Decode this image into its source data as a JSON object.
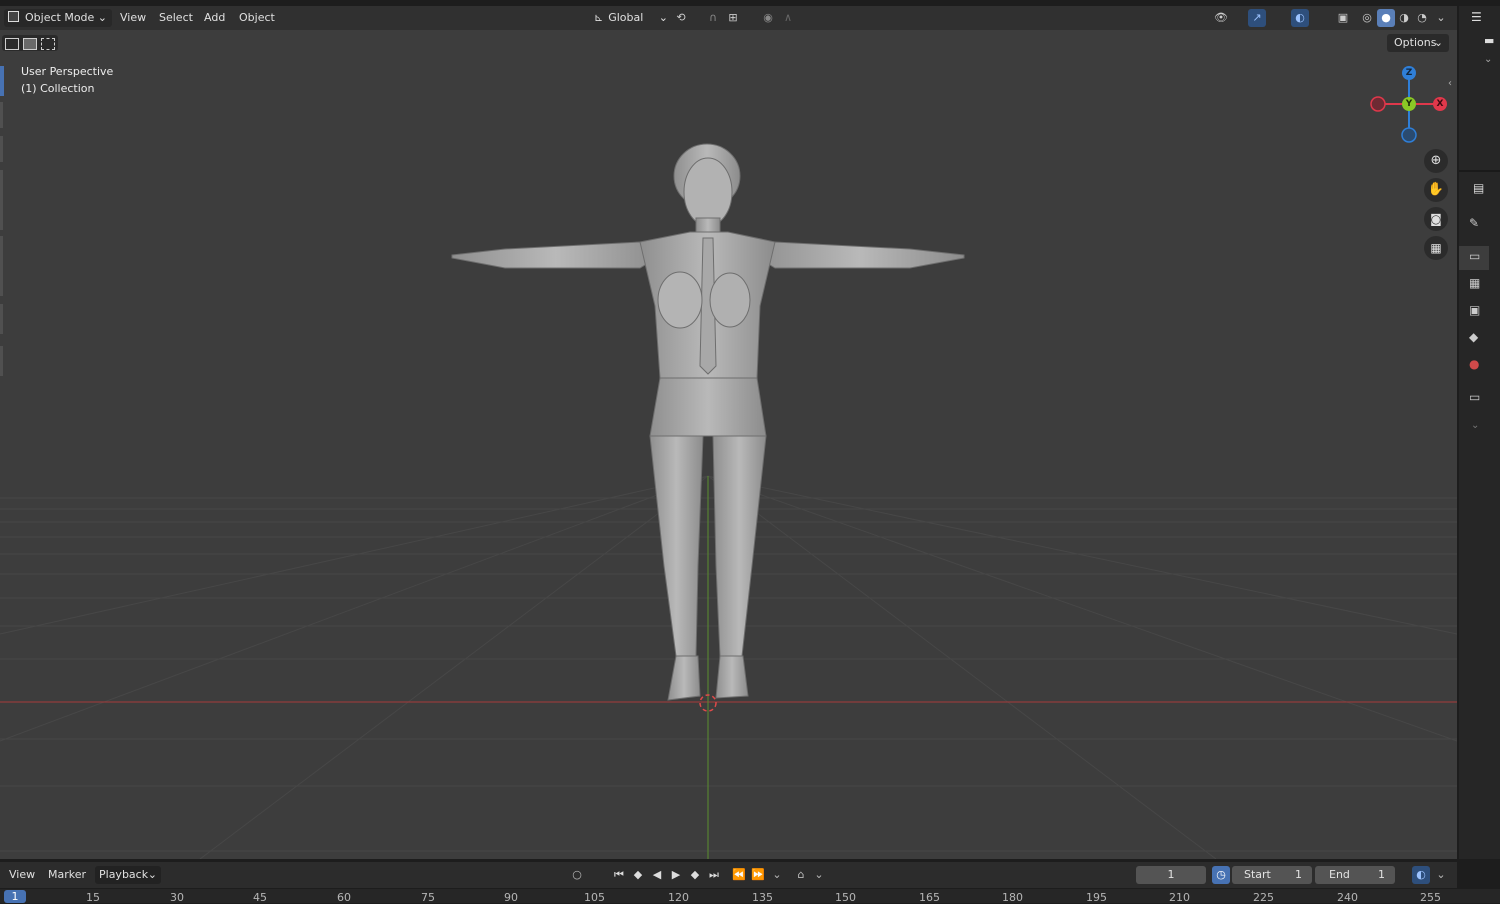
{
  "header": {
    "mode_label": "Object Mode",
    "menus": [
      "View",
      "Select",
      "Add",
      "Object"
    ],
    "orientation_label": "Global",
    "options_label": "Options"
  },
  "viewport": {
    "view_name": "User Perspective",
    "collection": "(1) Collection"
  },
  "gizmo": {
    "z_label": "Z",
    "y_label": "Y",
    "x_label": "X",
    "z_color": "#2f7fd8",
    "y_color": "#8ac926",
    "x_color": "#e0384b"
  },
  "timeline": {
    "menus": [
      "View",
      "Marker"
    ],
    "playback_label": "Playback",
    "current_frame": "1",
    "start_label": "Start",
    "start_value": "1",
    "end_label": "End",
    "end_value": "1",
    "ruler_current": "1",
    "ruler_ticks": [
      "15",
      "30",
      "45",
      "60",
      "75",
      "90",
      "105",
      "120",
      "135",
      "150",
      "165",
      "180",
      "195",
      "210",
      "225",
      "240",
      "255"
    ]
  },
  "colors": {
    "accent_blue": "#4772b3",
    "x_axis_red": "#a63a3a",
    "y_axis_green": "#5b8f2f",
    "viewport_bg": "#3d3d3d"
  }
}
